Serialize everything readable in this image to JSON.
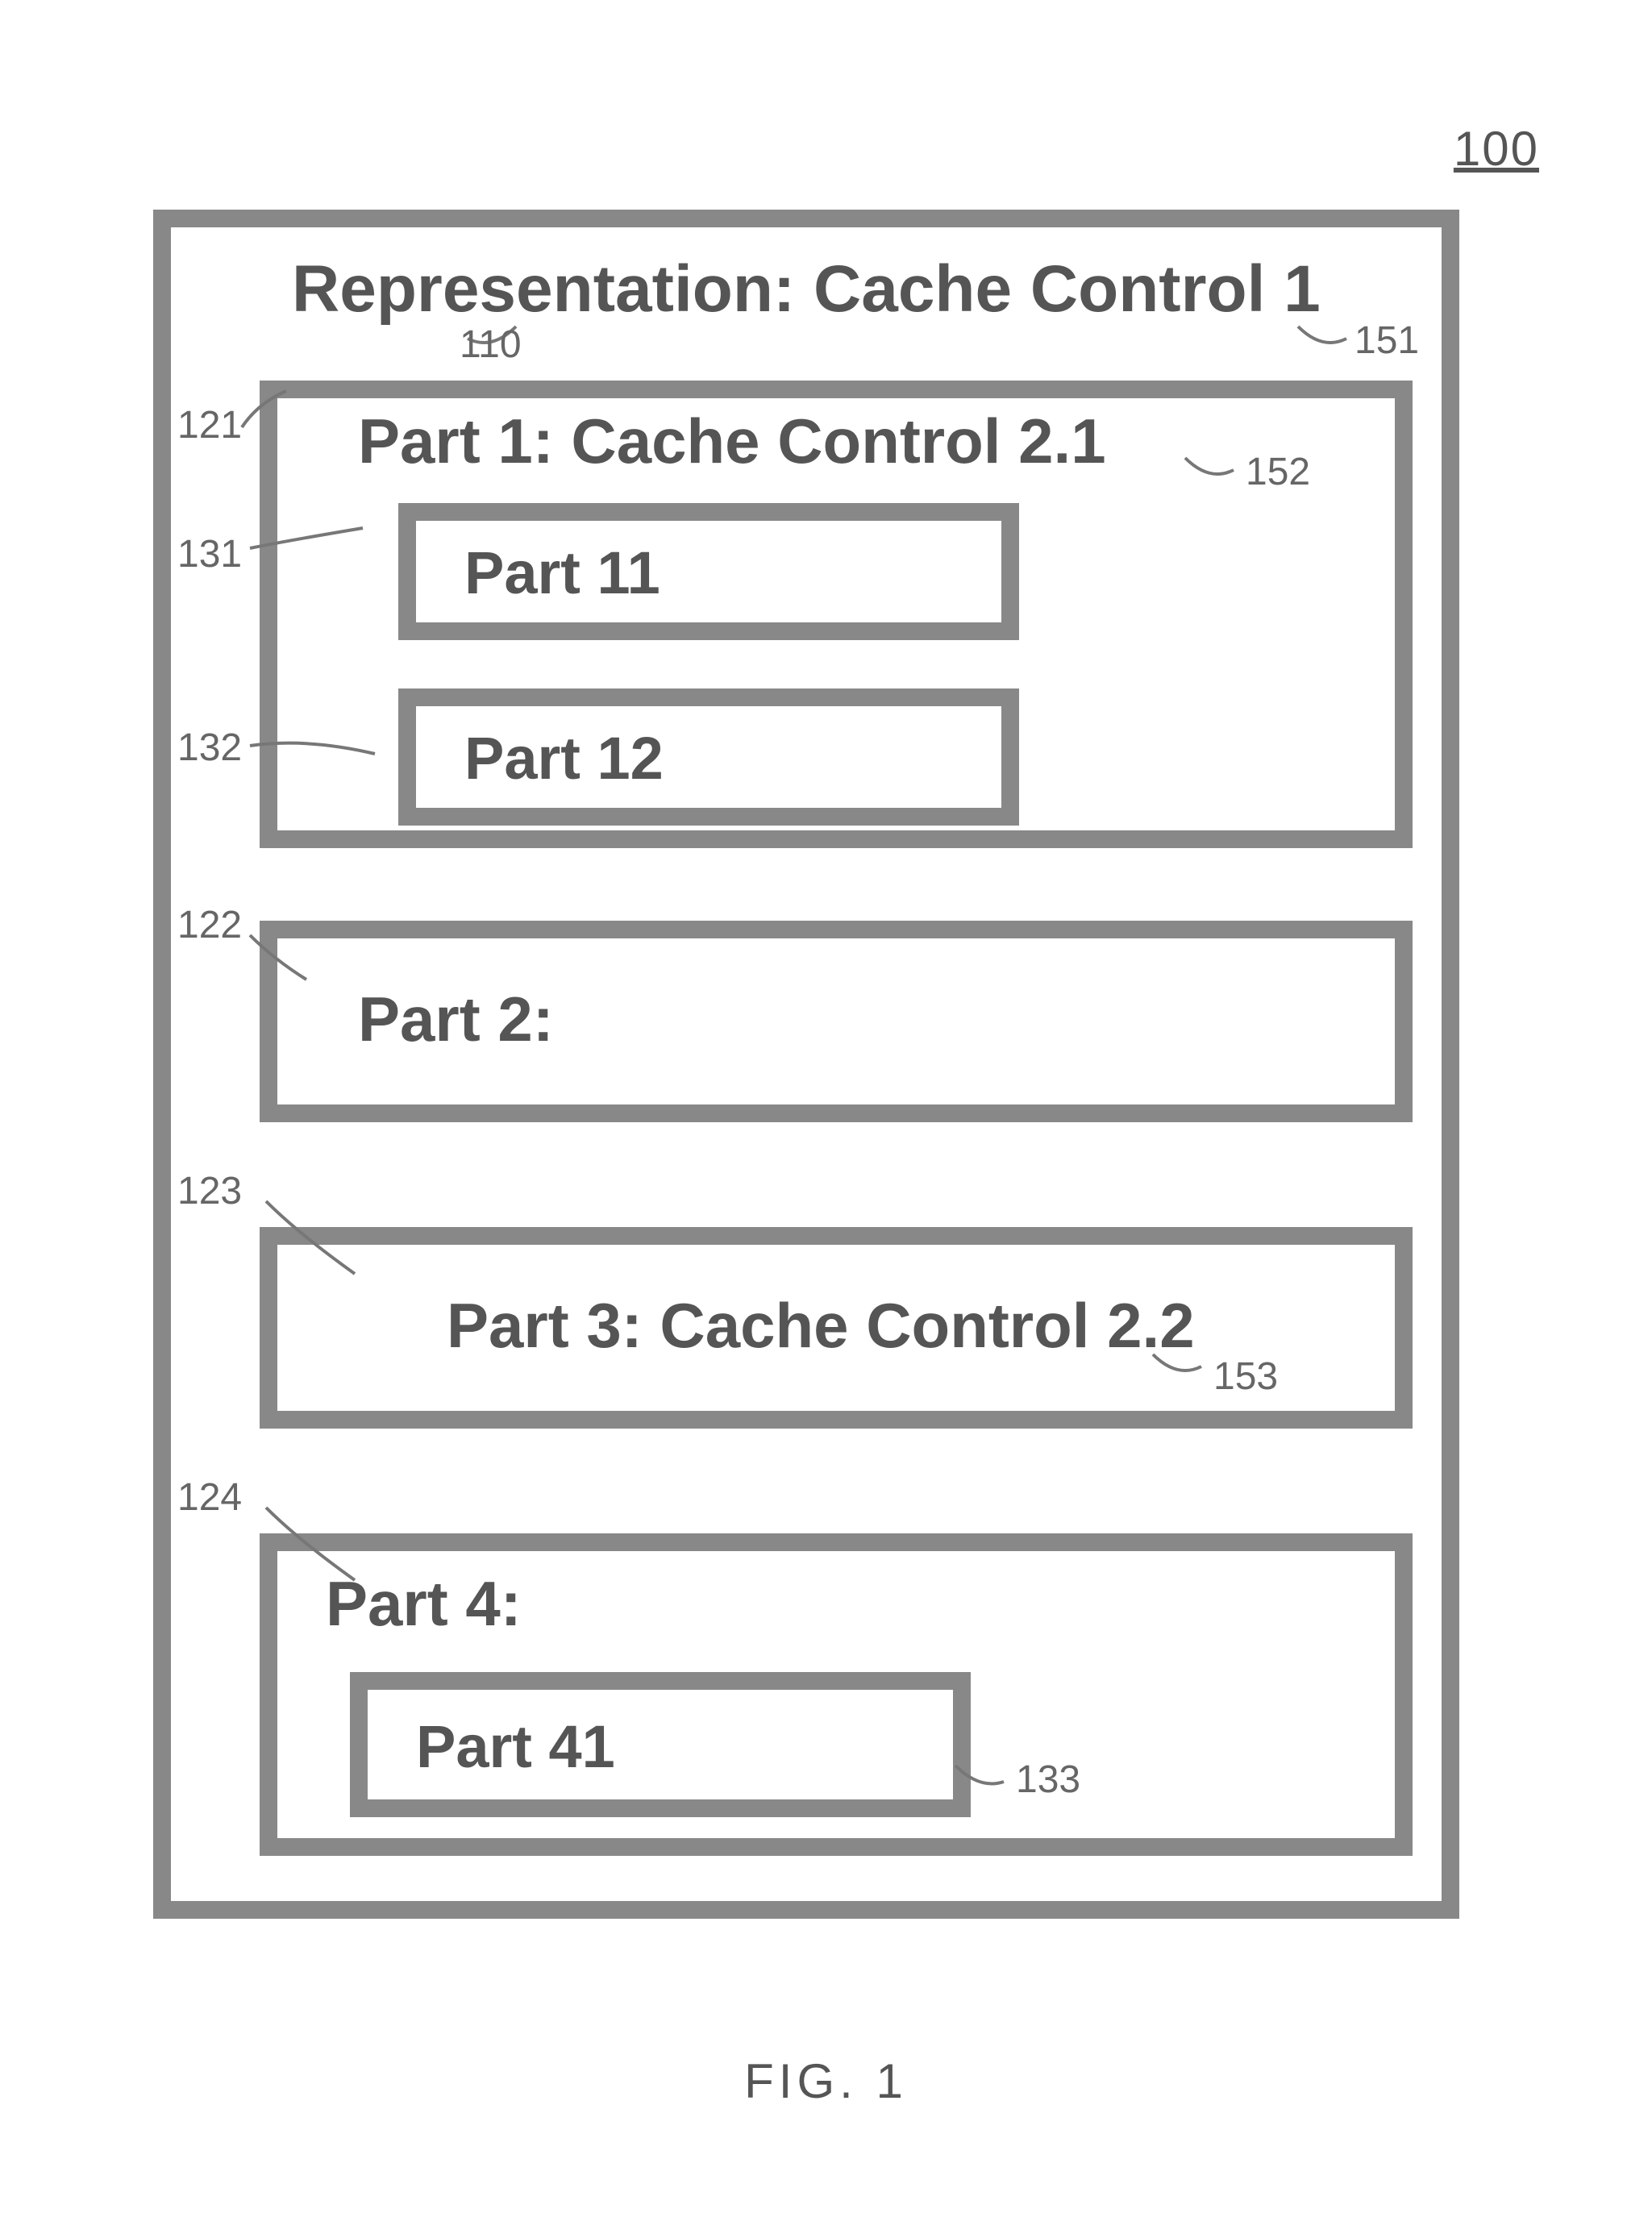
{
  "figure_number": "100",
  "figure_caption": "FIG. 1",
  "representation": {
    "title": "Representation: Cache Control 1",
    "ref_title": "110",
    "ref_cc": "151",
    "parts": [
      {
        "id": "part1",
        "label": "Part 1: Cache Control 2.1",
        "ref_box": "121",
        "ref_cc": "152",
        "children": [
          {
            "id": "part11",
            "label": "Part 11",
            "ref": "131"
          },
          {
            "id": "part12",
            "label": "Part 12",
            "ref": "132"
          }
        ]
      },
      {
        "id": "part2",
        "label": "Part 2:",
        "ref_box": "122"
      },
      {
        "id": "part3",
        "label": "Part 3: Cache Control 2.2",
        "ref_box": "123",
        "ref_cc": "153"
      },
      {
        "id": "part4",
        "label": "Part 4:",
        "ref_box": "124",
        "children": [
          {
            "id": "part41",
            "label": "Part 41",
            "ref": "133"
          }
        ]
      }
    ]
  }
}
